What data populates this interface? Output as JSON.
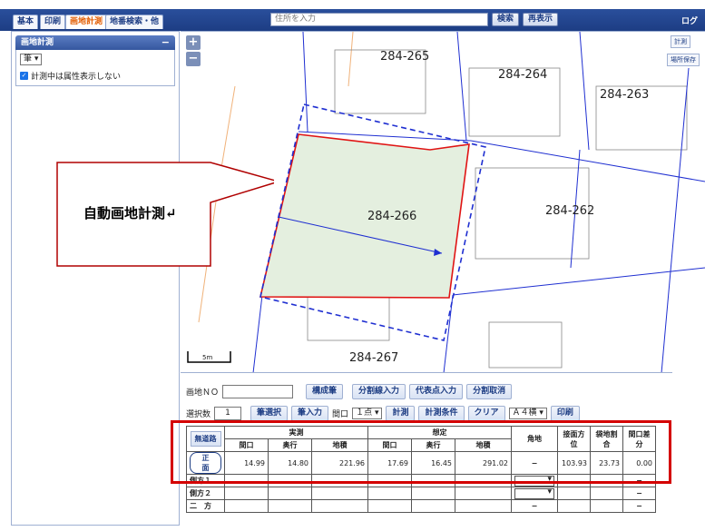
{
  "tabs": [
    "基本",
    "印刷",
    "画地計測",
    "地番検索・他"
  ],
  "address_placeholder": "住所を入力",
  "toolbar": {
    "search": "検索",
    "redisplay": "再表示",
    "login": "ログ"
  },
  "panel": {
    "title": "画地計測",
    "collapse": "−",
    "select_value": "筆",
    "checkbox_label": "計測中は属性表示しない"
  },
  "map": {
    "zoom_in": "+",
    "zoom_out": "−",
    "btn_measure": "計測",
    "btn_save": "場所保存",
    "callout": "自動画地計測↵",
    "parcels": [
      "284-265",
      "284-264",
      "284-263",
      "284-266",
      "284-262",
      "284-267"
    ],
    "scale": "5m"
  },
  "controls": {
    "lot_no_label": "画地ＮＯ",
    "btn_compose": "構成筆",
    "btn_split_line": "分割線入力",
    "btn_rep_point": "代表点入力",
    "btn_split_cancel": "分割取消",
    "sel_count_label": "選択数",
    "sel_count": "1",
    "btn_select": "筆選択",
    "btn_input": "筆入力",
    "frontage_label": "間口",
    "frontage_value": "１点",
    "btn_measure": "計測",
    "btn_conditions": "計測条件",
    "btn_clear": "クリア",
    "paper_value": "Ａ４横",
    "btn_print": "印刷"
  },
  "table": {
    "no_road": "無道路",
    "group_actual": "実測",
    "group_assumed": "想定",
    "cols": [
      "間口",
      "奥行",
      "地積",
      "間口",
      "奥行",
      "地積"
    ],
    "corner": "角地",
    "direction": "接面方位",
    "ratio": "袋地割合",
    "diff": "間口差分",
    "rows": [
      {
        "label": "正　面",
        "values": [
          "14.99",
          "14.80",
          "221.96",
          "17.69",
          "16.45",
          "291.02"
        ],
        "corner": "−",
        "direction": "103.93",
        "ratio": "23.73",
        "diff": "0.00"
      },
      {
        "label": "側方１",
        "values": [
          "",
          "",
          "",
          "",
          "",
          ""
        ],
        "corner": "",
        "direction": "",
        "ratio": "",
        "diff": "−"
      },
      {
        "label": "側方２",
        "values": [
          "",
          "",
          "",
          "",
          "",
          ""
        ],
        "corner": "",
        "direction": "",
        "ratio": "",
        "diff": "−"
      },
      {
        "label": "二　方",
        "values": [
          "",
          "",
          "",
          "",
          "",
          ""
        ],
        "corner": "−",
        "direction": "",
        "ratio": "",
        "diff": "−"
      }
    ]
  }
}
